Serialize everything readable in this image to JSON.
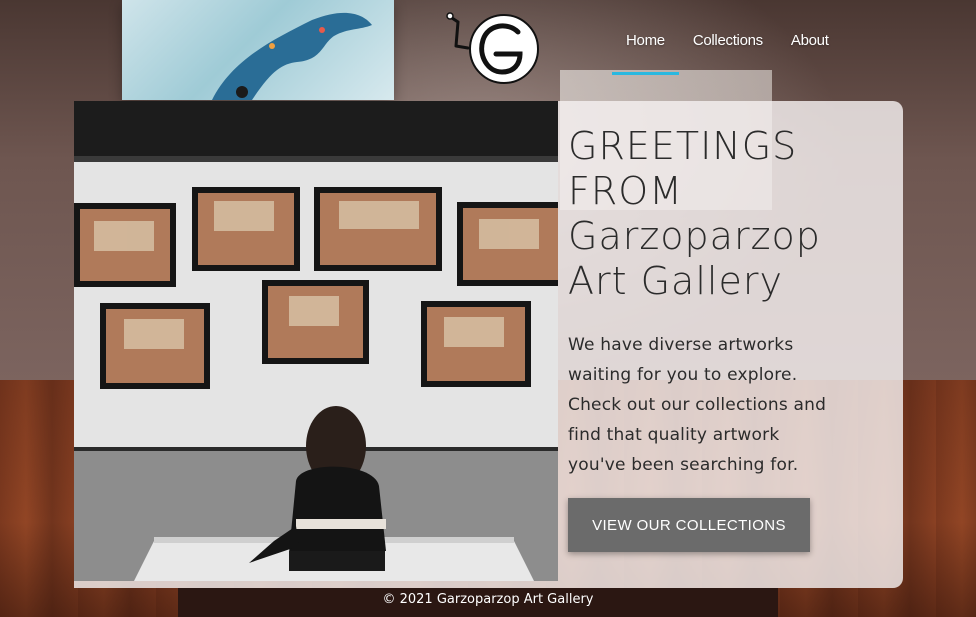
{
  "nav": {
    "logo_alt": "Garzoparzop Art Gallery logo",
    "items": [
      {
        "label": "Home",
        "active": true
      },
      {
        "label": "Collections",
        "active": false
      },
      {
        "label": "About",
        "active": false
      }
    ],
    "accent_color": "#29b8e0"
  },
  "hero": {
    "title_lines": [
      "GREETINGS",
      "FROM",
      "Garzoparzop",
      "Art Gallery"
    ],
    "description": "We have diverse artworks waiting for you to explore. Check out our collections and find that quality artwork you've been searching for.",
    "cta_label": "VIEW OUR COLLECTIONS",
    "image_alt": "woman sitting on a bench viewing framed gallery photographs"
  },
  "footer": {
    "copyright": "© 2021 Garzoparzop Art Gallery"
  },
  "colors": {
    "panel": "#f5f0f0",
    "button": "#6b6b6b",
    "text": "#2b2b2b"
  }
}
